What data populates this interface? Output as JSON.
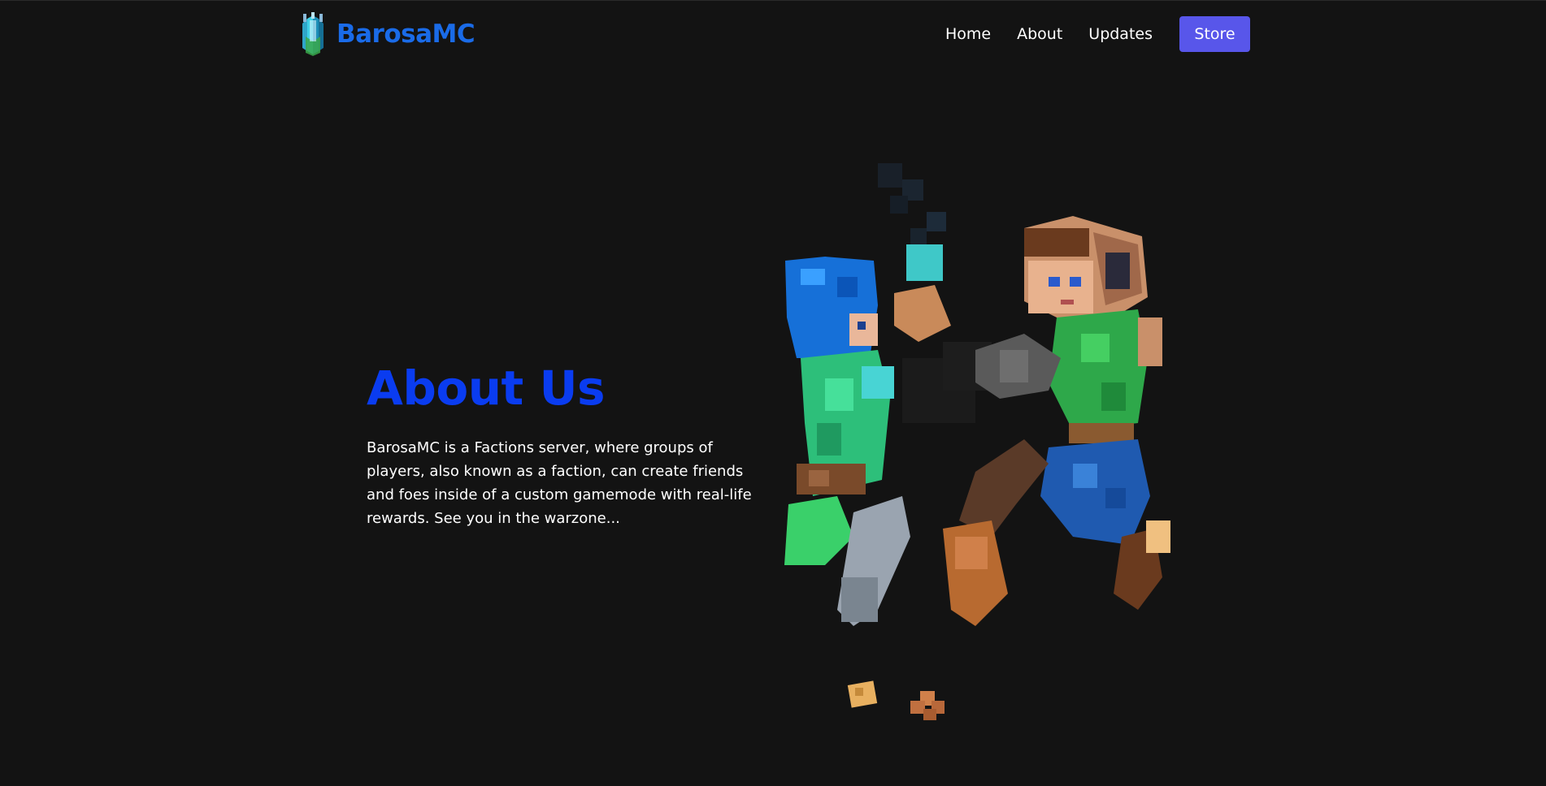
{
  "header": {
    "brand_name": "BarosaMC",
    "logo_icon": "crystal-logo-icon",
    "nav_links": [
      "Home",
      "About",
      "Updates"
    ],
    "store_label": "Store"
  },
  "about": {
    "title": "About Us",
    "text": "BarosaMC is a Factions server, where groups of players, also known as a faction, can create friends and foes inside of a custom gamemode with real-life rewards. See you in the warzone..."
  },
  "illustration": {
    "icon": "minecraft-characters-fighting-illustration"
  },
  "colors": {
    "background": "#131313",
    "brand": "#1a6be8",
    "title": "#0a3cf0",
    "store_button": "#5856ea",
    "text": "#ffffff"
  }
}
